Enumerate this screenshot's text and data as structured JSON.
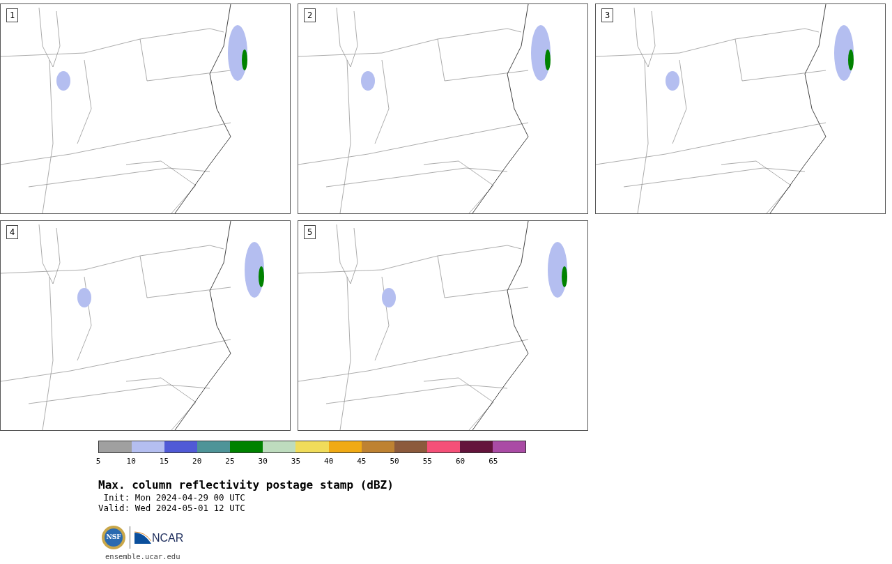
{
  "panels": [
    {
      "label": "1"
    },
    {
      "label": "2"
    },
    {
      "label": "3"
    },
    {
      "label": "4"
    },
    {
      "label": "5"
    }
  ],
  "colorbar": {
    "segments": [
      {
        "tick": "5",
        "color": "#a0a0a0"
      },
      {
        "tick": "10",
        "color": "#b4bef0"
      },
      {
        "tick": "15",
        "color": "#505ad6"
      },
      {
        "tick": "20",
        "color": "#4e9498"
      },
      {
        "tick": "25",
        "color": "#008200"
      },
      {
        "tick": "30",
        "color": "#bedcbe"
      },
      {
        "tick": "35",
        "color": "#f0dc5a"
      },
      {
        "tick": "40",
        "color": "#f0aa14"
      },
      {
        "tick": "45",
        "color": "#be8232"
      },
      {
        "tick": "50",
        "color": "#8c5a3c"
      },
      {
        "tick": "55",
        "color": "#f55078"
      },
      {
        "tick": "60",
        "color": "#64143c"
      },
      {
        "tick": "65",
        "color": "#aa4ba5"
      }
    ]
  },
  "title": "Max. column reflectivity postage stamp (dBZ)",
  "init": " Init: Mon 2024-04-29 00 UTC",
  "valid": "Valid: Wed 2024-05-01 12 UTC",
  "logos": {
    "nsf": "NSF",
    "ncar": "NCAR"
  },
  "footer": "ensemble.ucar.edu"
}
